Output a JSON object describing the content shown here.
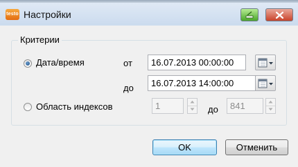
{
  "window": {
    "title": "Настройки",
    "app_icon_text": "testo"
  },
  "criteria": {
    "legend": "Критерии",
    "datetime": {
      "label": "Дата/время",
      "selected": true,
      "from_label": "от",
      "from_value": "16.07.2013 00:00:00",
      "to_label": "до",
      "to_value": "16.07.2013 14:00:00"
    },
    "index_range": {
      "label": "Область индексов",
      "selected": false,
      "from_value": "1",
      "to_label": "до",
      "to_value": "841"
    }
  },
  "buttons": {
    "ok": "OK",
    "cancel": "Отменить"
  },
  "colors": {
    "titlebar": "#cbdbee",
    "minimize_button": "#4aa62a",
    "close_button": "#c9442b",
    "default_button_border": "#3c7fb1"
  },
  "icons": {
    "app": "testo-logo-icon",
    "minimize": "minimize-icon",
    "close": "close-icon",
    "calendar_dropdown": "calendar-dropdown-icon",
    "spin_up": "spin-up-arrow-icon",
    "spin_down": "spin-down-arrow-icon"
  }
}
